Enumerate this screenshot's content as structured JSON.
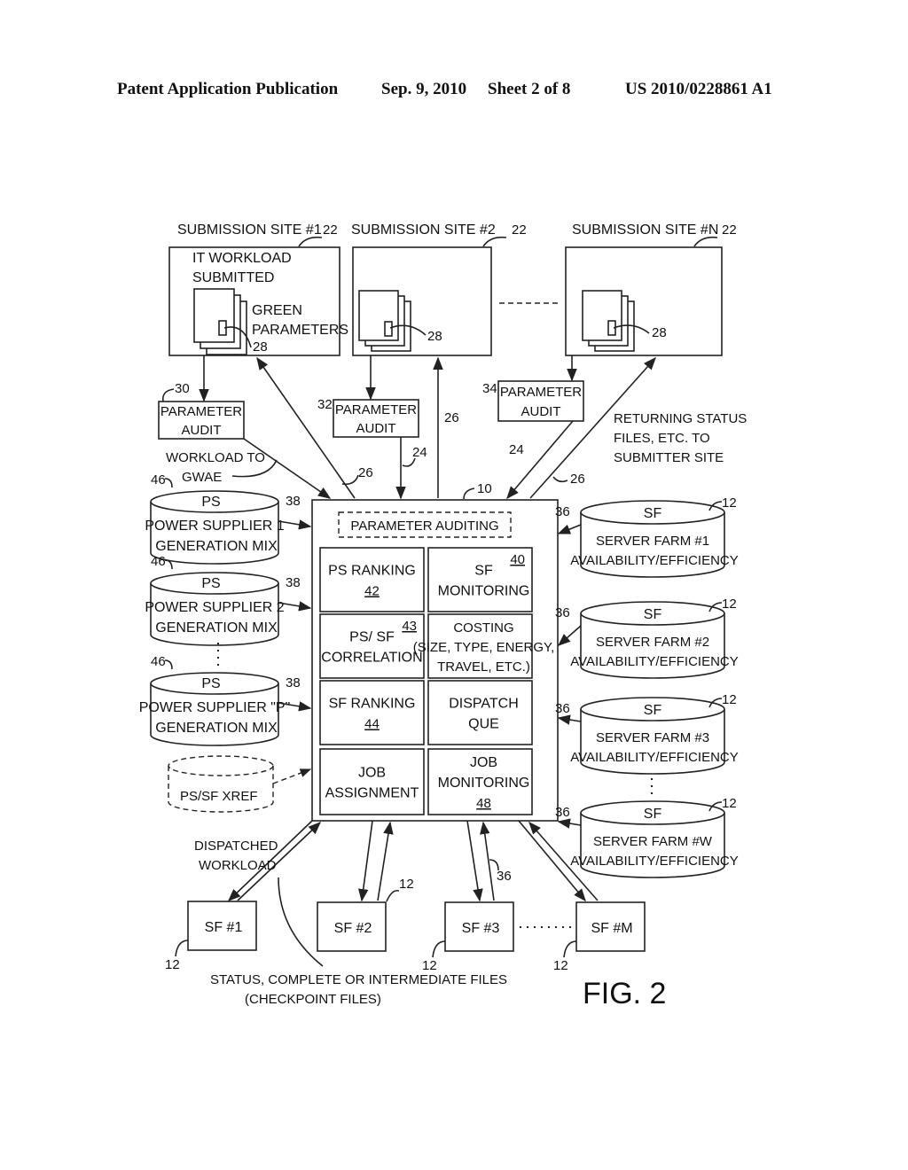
{
  "header": {
    "publication": "Patent Application Publication",
    "date": "Sep. 9, 2010",
    "sheet": "Sheet 2 of 8",
    "pub_number": "US 2010/0228861 A1"
  },
  "figure": {
    "title": "FIG. 2",
    "submission_sites": [
      {
        "label": "SUBMISSION SITE #1",
        "ref": "22",
        "content_lines": [
          "IT WORKLOAD",
          "SUBMITTED"
        ],
        "doc_label": [
          "GREEN",
          "PARAMETERS"
        ],
        "doc_ref": "28"
      },
      {
        "label": "SUBMISSION SITE #2",
        "ref": "22",
        "doc_ref": "28"
      },
      {
        "label": "SUBMISSION SITE #N",
        "ref": "22",
        "doc_ref": "28"
      }
    ],
    "parameter_audits": [
      {
        "lines": [
          "PARAMETER",
          "AUDIT"
        ],
        "ref": "30"
      },
      {
        "lines": [
          "PARAMETER",
          "AUDIT"
        ],
        "ref": "32"
      },
      {
        "lines": [
          "PARAMETER",
          "AUDIT"
        ],
        "ref": "34"
      }
    ],
    "flow_labels": {
      "workload_to_gwae": [
        "WORKLOAD TO",
        "GWAE"
      ],
      "returning_status": [
        "RETURNING STATUS",
        "FILES, ETC. TO",
        "SUBMITTER SITE"
      ],
      "dispatched_workload": [
        "DISPATCHED",
        "WORKLOAD"
      ],
      "status_files": [
        "STATUS, COMPLETE OR INTERMEDIATE FILES",
        "(CHECKPOINT FILES)"
      ]
    },
    "refs": {
      "r24": "24",
      "r26": "26",
      "r10": "10",
      "r38": "38",
      "r46": "46",
      "r36": "36",
      "r12": "12"
    },
    "gwae": {
      "ref": "10",
      "parameter_auditing": "PARAMETER AUDITING",
      "modules": [
        {
          "lines": [
            "PS RANKING"
          ],
          "ref": "42"
        },
        {
          "lines": [
            "SF",
            "MONITORING"
          ],
          "ref": "40"
        },
        {
          "lines": [
            "PS/ SF",
            "CORRELATION"
          ],
          "ref": "43"
        },
        {
          "lines": [
            "COSTING",
            "(SIZE, TYPE, ENERGY,",
            "TRAVEL, ETC.)"
          ],
          "ref": ""
        },
        {
          "lines": [
            "SF RANKING"
          ],
          "ref": "44"
        },
        {
          "lines": [
            "DISPATCH",
            "QUE"
          ],
          "ref": ""
        },
        {
          "lines": [
            "JOB",
            "ASSIGNMENT"
          ],
          "ref": ""
        },
        {
          "lines": [
            "JOB",
            "MONITORING"
          ],
          "ref": "48"
        }
      ]
    },
    "power_suppliers": [
      {
        "title": "PS",
        "lines": [
          "POWER SUPPLIER 1",
          "GENERATION MIX"
        ],
        "ref": "46",
        "arrow_ref": "38"
      },
      {
        "title": "PS",
        "lines": [
          "POWER SUPPLIER 2",
          "GENERATION MIX"
        ],
        "ref": "46",
        "arrow_ref": "38"
      },
      {
        "title": "PS",
        "lines": [
          "POWER SUPPLIER \"P\"",
          "GENERATION MIX"
        ],
        "ref": "46",
        "arrow_ref": "38"
      }
    ],
    "xref": "PS/SF XREF",
    "server_farm_dbs": [
      {
        "title": "SF",
        "lines": [
          "SERVER FARM #1",
          "AVAILABILITY/EFFICIENCY"
        ],
        "ref": "12",
        "arrow_ref": "36"
      },
      {
        "title": "SF",
        "lines": [
          "SERVER FARM #2",
          "AVAILABILITY/EFFICIENCY"
        ],
        "ref": "12",
        "arrow_ref": "36"
      },
      {
        "title": "SF",
        "lines": [
          "SERVER FARM #3",
          "AVAILABILITY/EFFICIENCY"
        ],
        "ref": "12",
        "arrow_ref": "36"
      },
      {
        "title": "SF",
        "lines": [
          "SERVER FARM #W",
          "AVAILABILITY/EFFICIENCY"
        ],
        "ref": "12",
        "arrow_ref": "36"
      }
    ],
    "server_farms": [
      {
        "label": "SF #1",
        "ref": "12"
      },
      {
        "label": "SF #2",
        "ref": "12"
      },
      {
        "label": "SF #3",
        "ref": "12"
      },
      {
        "label": "SF  #M",
        "ref": "12"
      }
    ]
  }
}
